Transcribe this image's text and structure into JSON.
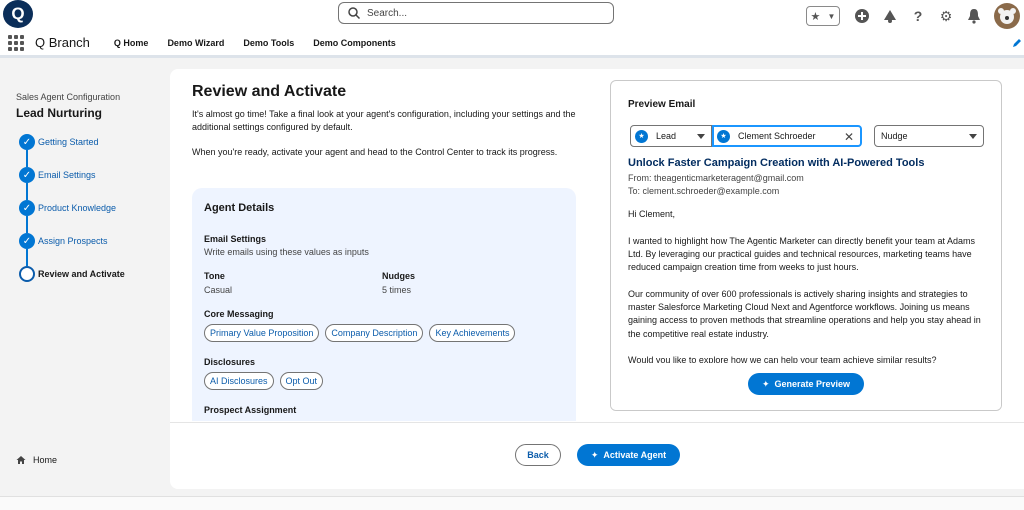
{
  "header": {
    "logo_letter": "Q",
    "search_placeholder": "Search..."
  },
  "nav": {
    "app_name": "Q Branch",
    "items": [
      "Q Home",
      "Demo Wizard",
      "Demo Tools",
      "Demo Components"
    ]
  },
  "sidebar": {
    "subtitle": "Sales Agent Configuration",
    "title": "Lead Nurturing",
    "steps": [
      {
        "label": "Getting Started",
        "status": "complete"
      },
      {
        "label": "Email Settings",
        "status": "complete"
      },
      {
        "label": "Product Knowledge",
        "status": "complete"
      },
      {
        "label": "Assign Prospects",
        "status": "complete"
      },
      {
        "label": "Review and Activate",
        "status": "current"
      }
    ],
    "home_label": "Home"
  },
  "main": {
    "title": "Review and Activate",
    "intro1": "It's almost go time! Take a final look at your agent's configuration, including your settings and the additional settings configured by default.",
    "intro2": "When you're ready, activate your agent and head to the Control Center to track its progress.",
    "details": {
      "heading": "Agent Details",
      "email_settings_title": "Email Settings",
      "email_settings_value": "Write emails using these values as inputs",
      "tone_title": "Tone",
      "tone_value": "Casual",
      "nudges_title": "Nudges",
      "nudges_value": "5 times",
      "core_messaging_title": "Core Messaging",
      "core_messaging": [
        "Primary Value Proposition",
        "Company Description",
        "Key Achievements"
      ],
      "disclosures_title": "Disclosures",
      "disclosures": [
        "AI Disclosures",
        "Opt Out"
      ],
      "prospect_assignment_title": "Prospect Assignment"
    },
    "back_label": "Back",
    "activate_label": "Activate Agent"
  },
  "preview": {
    "title": "Preview Email",
    "type_value": "Lead",
    "name_value": "Clement Schroeder",
    "nudge_value": "Nudge",
    "subject": "Unlock Faster Campaign Creation with AI-Powered Tools",
    "from": "From: theagenticmarketeragent@gmail.com",
    "to": "To: clement.schroeder@example.com",
    "greeting": "Hi Clement,",
    "para1": "I wanted to highlight how The Agentic Marketer can directly benefit your team at Adams Ltd. By leveraging our practical guides and technical resources, marketing teams have reduced campaign creation time from weeks to just hours.",
    "para2": "Our community of over 600 professionals is actively sharing insights and strategies to master Salesforce Marketing Cloud Next and Agentforce workflows. Joining us means gaining access to proven methods that streamline operations and help you stay ahead in the competitive real estate industry.",
    "para3": "Would you like to explore how we can help your team achieve similar results?",
    "generate_label": "Generate Preview"
  },
  "colors": {
    "brand_blue": "#0176d3",
    "dark_blue": "#032d60",
    "details_bg": "#eef4ff"
  }
}
